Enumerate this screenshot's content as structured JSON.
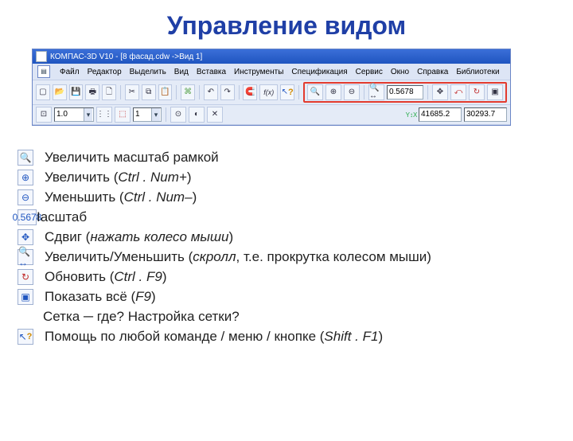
{
  "slide": {
    "title": "Управление видом"
  },
  "window": {
    "title": "КОМПАС-3D V10 - [8 фасад.cdw ->Вид 1]"
  },
  "menu": {
    "file": "Файл",
    "edit": "Редактор",
    "select": "Выделить",
    "view": "Вид",
    "insert": "Вставка",
    "tools": "Инструменты",
    "spec": "Спецификация",
    "service": "Сервис",
    "window": "Окно",
    "help": "Справка",
    "libs": "Библиотеки"
  },
  "toolbar": {
    "zoom_value": "0.5678",
    "scale": "1.0",
    "view_num": "1",
    "coord_x": "41685.2",
    "coord_y": "30293.7",
    "fx": "f(x)"
  },
  "list": {
    "i1": "Увеличить масштаб рамкой",
    "i2a": "Увеличить (",
    "i2b": "Ctrl . Num+",
    "i2c": ")",
    "i3a": "Уменьшить (",
    "i3b": "Ctrl . Num–",
    "i3c": ")",
    "i4_zoom_value": "0.5678",
    "i4": "Іасштаб",
    "i5a": "Сдвиг (",
    "i5b": "нажать колесо мыши",
    "i5c": ")",
    "i6a": "Увеличить/Уменьшить (",
    "i6b": "скролл",
    "i6c": ", т.е. прокрутка колесом мыши)",
    "i7a": "Обновить (",
    "i7b": "Ctrl . F9",
    "i7c": ")",
    "i8a": "Показать всё (",
    "i8b": "F9",
    "i8c": ")",
    "i9a": "Сетка ",
    "i9b": "─",
    "i9c": " где? Настройка сетки?",
    "i10a": "Помощь по любой команде / меню / кнопке (",
    "i10b": "Shift . F1",
    "i10c": ")"
  }
}
